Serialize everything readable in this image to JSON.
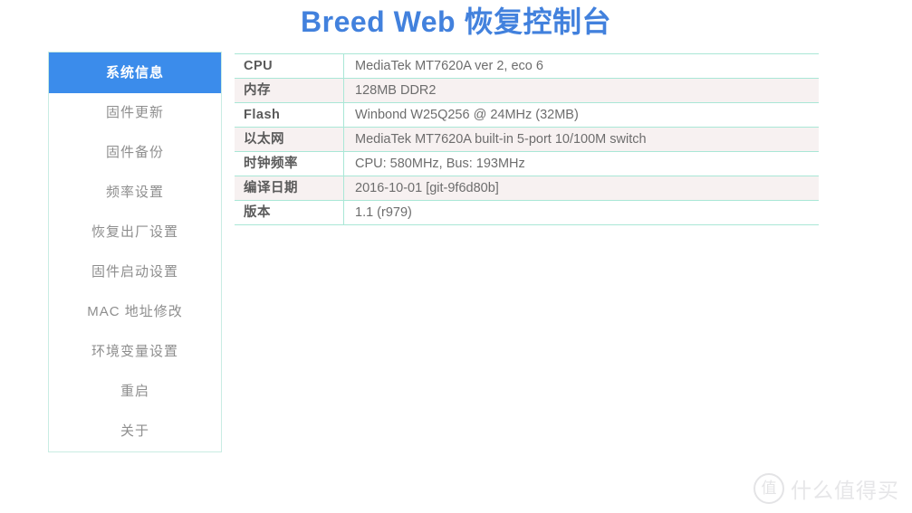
{
  "header": {
    "title": "Breed Web 恢复控制台",
    "title_color": "#4281dd"
  },
  "sidebar": {
    "active_index": 0,
    "active_bg_color": "#3b8ceb",
    "border_color": "#c9ece3",
    "items": [
      {
        "label": "系统信息",
        "active": true
      },
      {
        "label": "固件更新",
        "active": false
      },
      {
        "label": "固件备份",
        "active": false
      },
      {
        "label": "频率设置",
        "active": false
      },
      {
        "label": "恢复出厂设置",
        "active": false
      },
      {
        "label": "固件启动设置",
        "active": false
      },
      {
        "label": "MAC 地址修改",
        "active": false
      },
      {
        "label": "环境变量设置",
        "active": false
      },
      {
        "label": "重启",
        "active": false
      },
      {
        "label": "关于",
        "active": false
      }
    ]
  },
  "main": {
    "table": {
      "border_color": "#a9e7d6",
      "stripe_color": "#f7f1f1",
      "rows": [
        {
          "key": "CPU",
          "value": "MediaTek MT7620A ver 2, eco 6"
        },
        {
          "key": "内存",
          "value": "128MB DDR2"
        },
        {
          "key": "Flash",
          "value": "Winbond W25Q256 @ 24MHz (32MB)"
        },
        {
          "key": "以太网",
          "value": "MediaTek MT7620A built-in 5-port 10/100M switch"
        },
        {
          "key": "时钟频率",
          "value": "CPU: 580MHz, Bus: 193MHz"
        },
        {
          "key": "编译日期",
          "value": "2016-10-01 [git-9f6d80b]"
        },
        {
          "key": "版本",
          "value": "1.1 (r979)"
        }
      ]
    }
  },
  "watermark": {
    "mark": "值",
    "text": "什么值得买",
    "color": "#e6e6e8"
  }
}
